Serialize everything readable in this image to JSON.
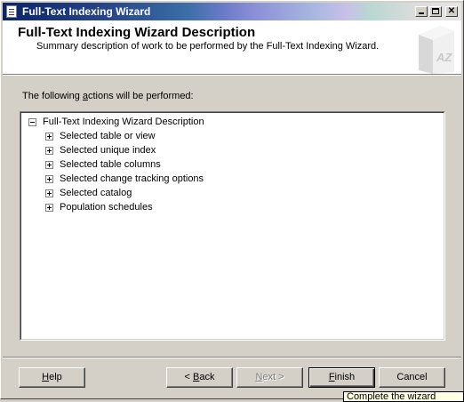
{
  "window": {
    "title": "Full-Text Indexing Wizard"
  },
  "header": {
    "title": "Full-Text Indexing Wizard Description",
    "subtitle": "Summary description of work to be performed by the Full-Text Indexing Wizard."
  },
  "section": {
    "label_before": "The following ",
    "label_underlined": "a",
    "label_after": "ctions will be performed:"
  },
  "tree": {
    "root": {
      "label": "Full-Text Indexing Wizard Description",
      "expanded": true
    },
    "children": [
      {
        "label": "Selected table or view",
        "expanded": false
      },
      {
        "label": "Selected unique index",
        "expanded": false
      },
      {
        "label": "Selected table columns",
        "expanded": false
      },
      {
        "label": "Selected change tracking options",
        "expanded": false
      },
      {
        "label": "Selected catalog",
        "expanded": false
      },
      {
        "label": "Population schedules",
        "expanded": false
      }
    ]
  },
  "buttons": {
    "help": {
      "mnemonic": "H",
      "rest": "elp",
      "enabled": true
    },
    "back": {
      "prefix": "< ",
      "mnemonic": "B",
      "rest": "ack",
      "enabled": true
    },
    "next": {
      "mnemonic": "N",
      "rest": "ext >",
      "enabled": false
    },
    "finish": {
      "mnemonic": "F",
      "rest": "inish",
      "enabled": true
    },
    "cancel": {
      "label": "Cancel",
      "enabled": true
    }
  },
  "tooltip": {
    "text": "Complete the wizard"
  },
  "colors": {
    "titlebar_start": "#0a246a",
    "face": "#d4d0c8",
    "tooltip_bg": "#ffffe1"
  }
}
